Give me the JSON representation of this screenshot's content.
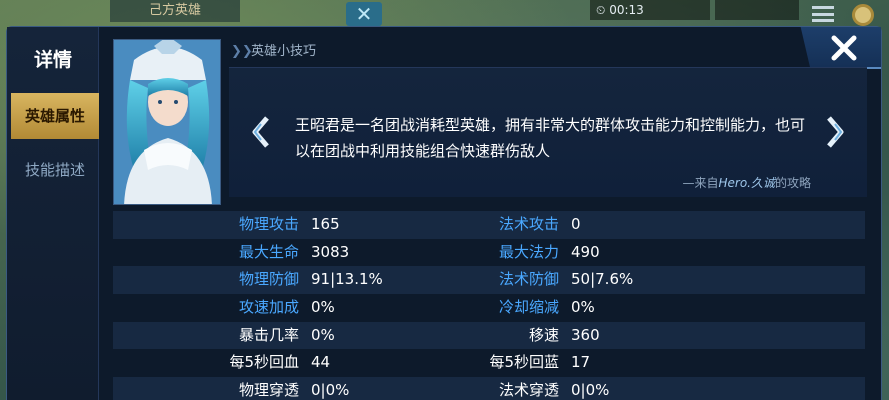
{
  "hud": {
    "team_label": "己方英雄",
    "timer": "00:13"
  },
  "sidebar": {
    "title": "详情",
    "tabs": [
      {
        "label": "英雄属性",
        "active": true
      },
      {
        "label": "技能描述",
        "active": false
      }
    ]
  },
  "tip": {
    "header": "英雄小技巧",
    "text": "王昭君是一名团战消耗型英雄，拥有非常大的群体攻击能力和控制能力，也可以在团战中利用技能组合快速群伤敌人",
    "source_prefix": "—来自",
    "source_author": "Hero.久诚",
    "source_suffix": "的攻略"
  },
  "stats": [
    {
      "l1": "物理攻击",
      "v1": "165",
      "l2": "法术攻击",
      "v2": "0",
      "blue": true
    },
    {
      "l1": "最大生命",
      "v1": "3083",
      "l2": "最大法力",
      "v2": "490",
      "blue": true
    },
    {
      "l1": "物理防御",
      "v1": "91|13.1%",
      "l2": "法术防御",
      "v2": "50|7.6%",
      "blue": true
    },
    {
      "l1": "攻速加成",
      "v1": "0%",
      "l2": "冷却缩减",
      "v2": "0%",
      "blue": true
    },
    {
      "l1": "暴击几率",
      "v1": "0%",
      "l2": "移速",
      "v2": "360",
      "blue": false
    },
    {
      "l1": "每5秒回血",
      "v1": "44",
      "l2": "每5秒回蓝",
      "v2": "17",
      "blue": false
    },
    {
      "l1": "物理穿透",
      "v1": "0|0%",
      "l2": "法术穿透",
      "v2": "0|0%",
      "blue": false
    }
  ],
  "colors": {
    "panel_bg": "#0d1a2b",
    "tab_active": "#c9a04a",
    "stat_label_blue": "#4aa8ff"
  },
  "icons": {
    "close": "close-icon",
    "prev": "chevron-left-icon",
    "next": "chevron-right-icon"
  }
}
